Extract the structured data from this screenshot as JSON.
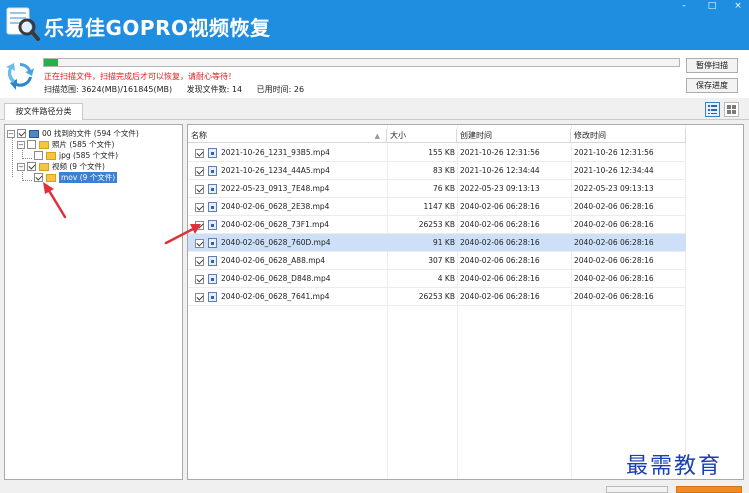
{
  "app": {
    "title": "乐易佳GOPRO视频恢复",
    "window_controls": [
      "-",
      "□",
      "×"
    ]
  },
  "scan": {
    "progress_fraction": 0.022,
    "message": "正在扫描文件，扫描完成后才可以恢复，请耐心等待！",
    "range_label": "扫描范围: 3624(MB)/161845(MB)",
    "found_label": "发现文件数: 14",
    "elapsed_label": "已用时间: 26",
    "pause_button": "暂停扫描",
    "save_button": "保存进度"
  },
  "tabs": [
    {
      "label": "按文件路径分类"
    }
  ],
  "tree": {
    "root": {
      "label": "00 找到的文件 (594 个文件)"
    },
    "photos": {
      "label": "照片  (585 个文件)"
    },
    "jpg": {
      "label": "jpg  (585 个文件)"
    },
    "video": {
      "label": "视频  (9 个文件)"
    },
    "mov": {
      "label": "mov  (9 个文件)"
    }
  },
  "list": {
    "columns": [
      "名称",
      "大小",
      "创建时间",
      "修改时间"
    ],
    "rows": [
      {
        "name": "2021-10-26_1231_93B5.mp4",
        "size": "155 KB",
        "created": "2021-10-26  12:31:56",
        "modified": "2021-10-26  12:31:56"
      },
      {
        "name": "2021-10-26_1234_44A5.mp4",
        "size": "83 KB",
        "created": "2021-10-26  12:34:44",
        "modified": "2021-10-26  12:34:44"
      },
      {
        "name": "2022-05-23_0913_7E48.mp4",
        "size": "76 KB",
        "created": "2022-05-23  09:13:13",
        "modified": "2022-05-23  09:13:13"
      },
      {
        "name": "2040-02-06_0628_2E38.mp4",
        "size": "1147 KB",
        "created": "2040-02-06  06:28:16",
        "modified": "2040-02-06  06:28:16"
      },
      {
        "name": "2040-02-06_0628_73F1.mp4",
        "size": "26253 KB",
        "created": "2040-02-06  06:28:16",
        "modified": "2040-02-06  06:28:16"
      },
      {
        "name": "2040-02-06_0628_760D.mp4",
        "size": "91 KB",
        "created": "2040-02-06  06:28:16",
        "modified": "2040-02-06  06:28:16"
      },
      {
        "name": "2040-02-06_0628_A88.mp4",
        "size": "307 KB",
        "created": "2040-02-06  06:28:16",
        "modified": "2040-02-06  06:28:16"
      },
      {
        "name": "2040-02-06_0628_D848.mp4",
        "size": "4 KB",
        "created": "2040-02-06  06:28:16",
        "modified": "2040-02-06  06:28:16"
      },
      {
        "name": "2040-02-06_0628_7641.mp4",
        "size": "26253 KB",
        "created": "2040-02-06  06:28:16",
        "modified": "2040-02-06  06:28:16"
      }
    ]
  },
  "watermark": "最需教育",
  "colors": {
    "titlebar": "#1f8ee0",
    "progress": "#22b14c",
    "status_text": "#e01a1a",
    "selection": "#cde0f7",
    "arrow": "#e0303a",
    "watermark": "#1a3fb0"
  }
}
